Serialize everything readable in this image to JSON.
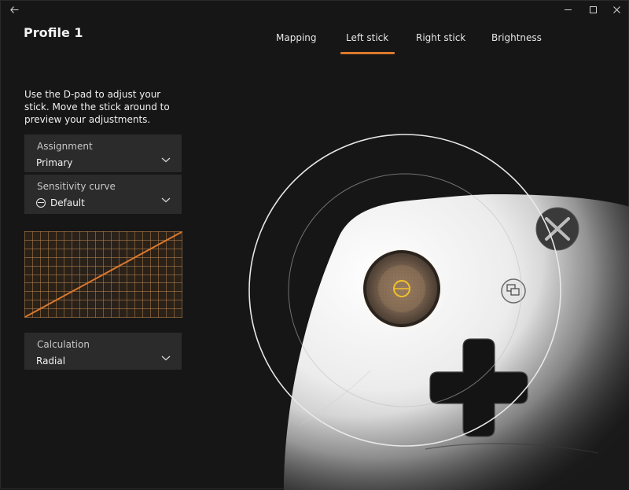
{
  "window": {
    "back_icon": "back-arrow-icon"
  },
  "header": {
    "profile_title": "Profile 1"
  },
  "tabs": [
    {
      "label": "Mapping",
      "active": false
    },
    {
      "label": "Left stick",
      "active": true
    },
    {
      "label": "Right stick",
      "active": false
    },
    {
      "label": "Brightness",
      "active": false
    }
  ],
  "instructions": "Use the D-pad to adjust your stick. Move the stick around to preview your adjustments.",
  "assignment": {
    "label": "Assignment",
    "value": "Primary"
  },
  "sensitivity": {
    "label": "Sensitivity curve",
    "value": "Default",
    "icon": "curve-default-icon"
  },
  "calculation": {
    "label": "Calculation",
    "value": "Radial"
  },
  "sensitivity_curve": {
    "points": [
      [
        0,
        0
      ],
      [
        1,
        1
      ]
    ]
  },
  "colors": {
    "accent": "#d9782d",
    "panel": "#2b2b2b",
    "background": "#161616",
    "grid": "#b7834f"
  }
}
